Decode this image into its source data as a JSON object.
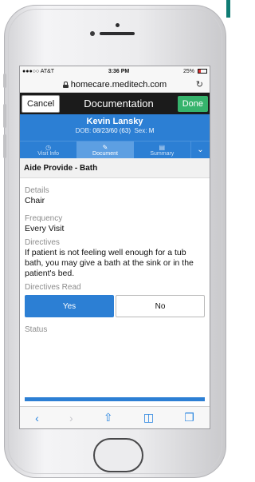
{
  "status_bar": {
    "carrier": "●●●○○ AT&T",
    "time": "3:36 PM",
    "battery": "25%"
  },
  "browser": {
    "url": "homecare.meditech.com",
    "reload_icon": "reload-icon"
  },
  "navbar": {
    "cancel_label": "Cancel",
    "title": "Documentation",
    "done_label": "Done"
  },
  "patient": {
    "name": "Kevin Lansky",
    "dob_label": "DOB:",
    "dob_value": "08/23/60 (63)",
    "sex_label": "Sex:",
    "sex_value": "M"
  },
  "tabs": [
    {
      "label": "Visit Info",
      "icon": "clock-icon"
    },
    {
      "label": "Document",
      "icon": "pencil-icon"
    },
    {
      "label": "Summary",
      "icon": "document-icon"
    }
  ],
  "section": {
    "title": "Aide Provide - Bath"
  },
  "fields": {
    "details_label": "Details",
    "details_value": "Chair",
    "frequency_label": "Frequency",
    "frequency_value": "Every Visit",
    "directives_label": "Directives",
    "directives_value": "If patient is not feeling well enough for a tub bath, you may give a bath at the sink or in the patient's bed.",
    "directives_read_label": "Directives Read",
    "status_label": "Status"
  },
  "directives_read": {
    "yes_label": "Yes",
    "no_label": "No",
    "selected": "Yes"
  },
  "colors": {
    "accent": "#2c7fd4",
    "done": "#36b36c",
    "navbar": "#1b1b1b"
  }
}
